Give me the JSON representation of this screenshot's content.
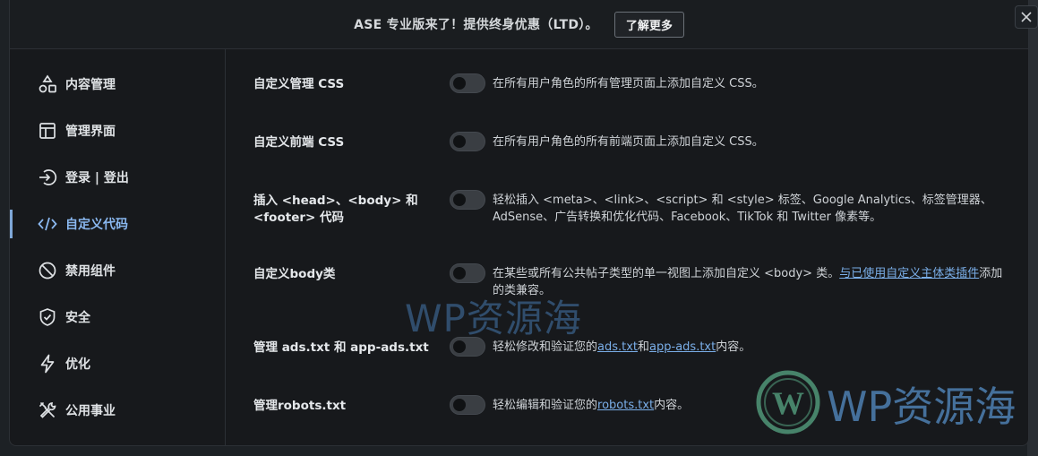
{
  "banner": {
    "text": "ASE 专业版来了！提供终身优惠（LTD）。",
    "button_label": "了解更多"
  },
  "close_icon": "close-icon",
  "sidebar": {
    "items": [
      {
        "label": "内容管理",
        "icon": "shapes-icon"
      },
      {
        "label": "管理界面",
        "icon": "layout-icon"
      },
      {
        "label": "登录 | 登出",
        "icon": "login-icon"
      },
      {
        "label": "自定义代码",
        "icon": "code-icon",
        "active": true
      },
      {
        "label": "禁用组件",
        "icon": "ban-icon"
      },
      {
        "label": "安全",
        "icon": "shield-check-icon"
      },
      {
        "label": "优化",
        "icon": "lightning-icon"
      },
      {
        "label": "公用事业",
        "icon": "tools-icon"
      }
    ]
  },
  "settings": [
    {
      "title": "自定义管理 CSS",
      "enabled": false,
      "desc": "在所有用户角色的所有管理页面上添加自定义 CSS。"
    },
    {
      "title": "自定义前端 CSS",
      "enabled": false,
      "desc": "在所有用户角色的所有前端页面上添加自定义 CSS。"
    },
    {
      "title": "插入 <head>、<body> 和 <footer> 代码",
      "enabled": false,
      "desc": "轻松插入 <meta>、<link>、<script> 和 <style> 标签、Google Analytics、标签管理器、AdSense、广告转换和优化代码、Facebook、TikTok 和 Twitter 像素等。"
    },
    {
      "title": "自定义body类",
      "enabled": false,
      "desc_pre": "在某些或所有公共帖子类型的单一视图上添加自定义 <body> 类。",
      "desc_link": "与已使用自定义主体类插件",
      "desc_post": "添加的类兼容。"
    },
    {
      "title": "管理 ads.txt 和 app-ads.txt",
      "enabled": false,
      "desc_pre": "轻松修改和验证您的",
      "link1": "ads.txt",
      "desc_mid": "和",
      "link2": "app-ads.txt",
      "desc_post": "内容。"
    },
    {
      "title": "管理robots.txt",
      "enabled": false,
      "desc_pre": "轻松编辑和验证您的",
      "link1": "robots.txt",
      "desc_post": "内容。"
    }
  ],
  "watermark": {
    "text1": "WP资源海",
    "text2": "WP资源海",
    "logo_icon": "wordpress-logo-icon"
  },
  "colors": {
    "background": "#17191c",
    "accent": "#7aaee8",
    "active_nav": "#8ab8f0"
  }
}
